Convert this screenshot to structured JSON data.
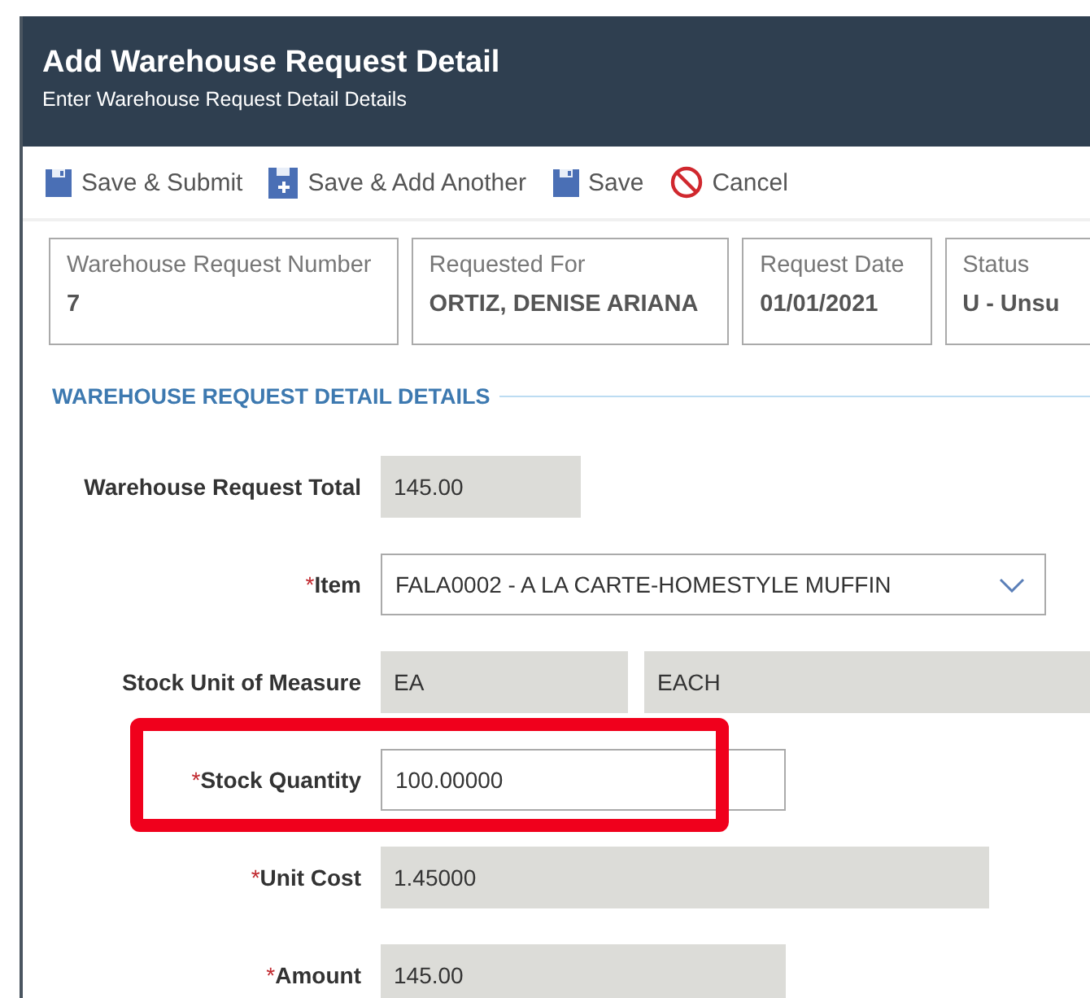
{
  "dialog": {
    "title": "Add Warehouse Request Detail",
    "subtitle": "Enter Warehouse Request Detail Details"
  },
  "toolbar": [
    {
      "label": "Save & Submit",
      "kind": "save"
    },
    {
      "label": "Save & Add Another",
      "kind": "save-add"
    },
    {
      "label": "Save",
      "kind": "save"
    },
    {
      "label": "Cancel",
      "kind": "cancel"
    }
  ],
  "summary": [
    {
      "label": "Warehouse Request Number",
      "value": "7"
    },
    {
      "label": "Requested For",
      "value": "ORTIZ, DENISE ARIANA"
    },
    {
      "label": "Request Date",
      "value": "01/01/2021"
    },
    {
      "label": "Status",
      "value": "U - Unsu"
    }
  ],
  "section": {
    "title": "WAREHOUSE REQUEST DETAIL DETAILS"
  },
  "fields": [
    {
      "label": "Warehouse Request Total",
      "highlighted": false,
      "inputs": [
        {
          "kind": "readonly",
          "value": "145.00"
        }
      ]
    },
    {
      "required_mark": "*",
      "label": "Item",
      "highlighted": false,
      "inputs": [
        {
          "kind": "dropdown",
          "value": "FALA0002 - A LA CARTE-HOMESTYLE MUFFIN"
        }
      ]
    },
    {
      "label": "Stock Unit of Measure",
      "highlighted": false,
      "inputs": [
        {
          "kind": "readonly",
          "value": "EA"
        },
        {
          "kind": "readonly",
          "value": "EACH"
        }
      ]
    },
    {
      "required_mark": "*",
      "label": "Stock Quantity",
      "highlighted": true,
      "inputs": [
        {
          "kind": "input",
          "value": "100.00000"
        }
      ]
    },
    {
      "required_mark": "*",
      "label": "Unit Cost",
      "highlighted": false,
      "inputs": [
        {
          "kind": "readonly",
          "value": "1.45000"
        }
      ]
    },
    {
      "required_mark": "*",
      "label": "Amount",
      "highlighted": false,
      "inputs": [
        {
          "kind": "readonly",
          "value": "145.00"
        }
      ]
    }
  ]
}
